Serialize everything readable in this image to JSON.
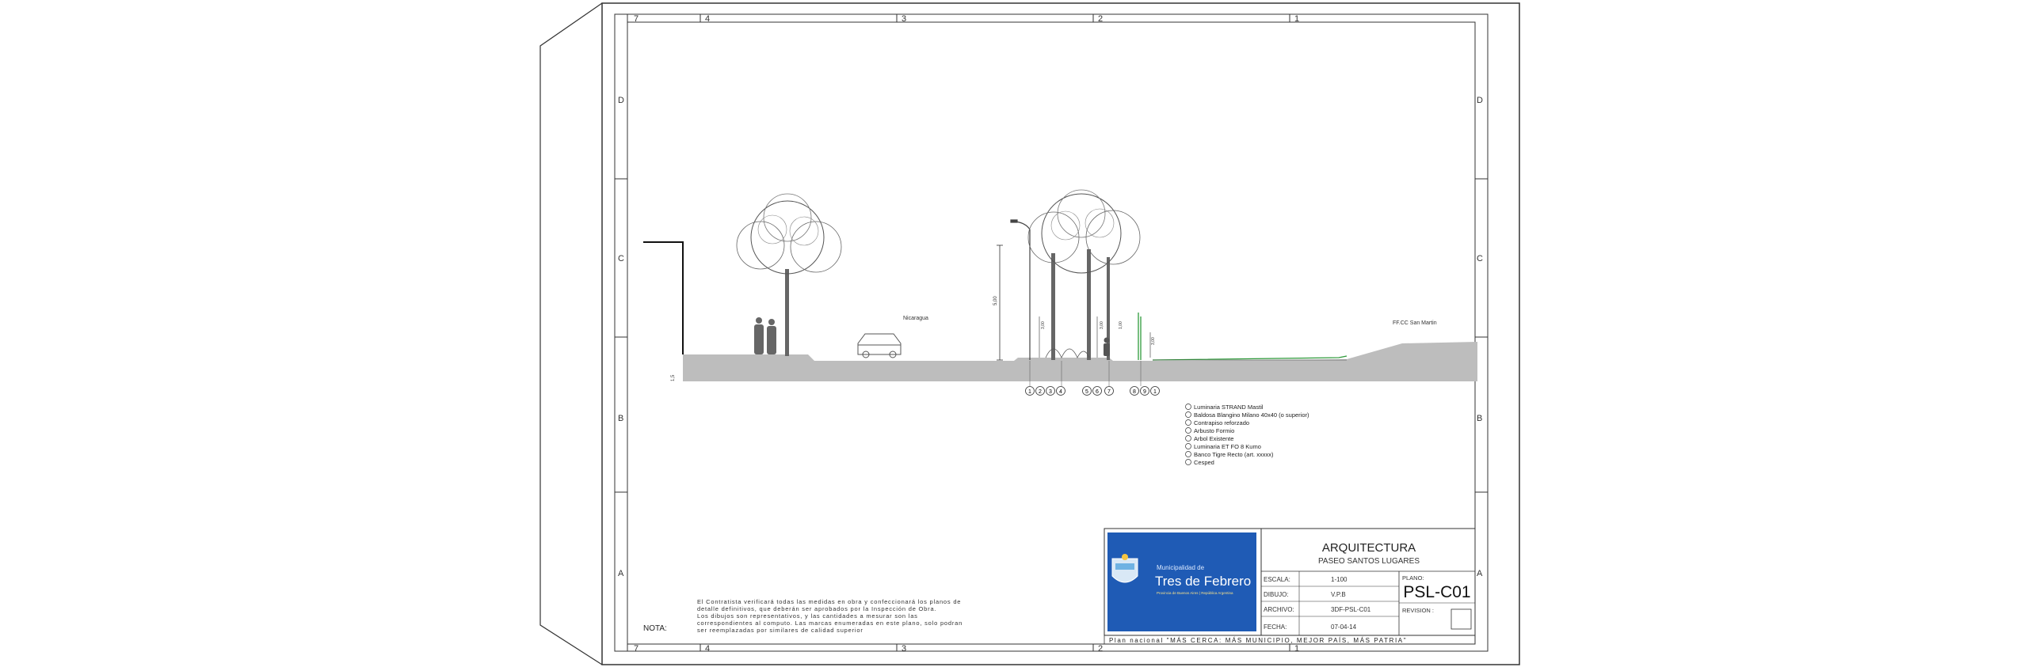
{
  "grid": {
    "top_cols": [
      "7",
      "4",
      "3",
      "2",
      "1"
    ],
    "bottom_cols": [
      "7",
      "4",
      "3",
      "2",
      "1"
    ],
    "left_rows": [
      "D",
      "C",
      "B",
      "A"
    ],
    "right_rows": [
      "D",
      "C",
      "B",
      "A"
    ]
  },
  "drawing": {
    "street_label": "Nicaragua",
    "rail_label": "FF.CC San Martin",
    "dims": [
      "5,00",
      "3,00",
      "3,00",
      "1,00",
      "3,00",
      "1,5"
    ],
    "markers": [
      "1",
      "2",
      "3",
      "4",
      "5",
      "6",
      "7",
      "8",
      "9",
      "1"
    ]
  },
  "legend": [
    "Luminaria STRAND Mastil",
    "Baldosa Blangino Milano 40x40 (o superior)",
    "Contrapiso reforzado",
    "Arbusto Formio",
    "Arbol Existente",
    "Luminaria ET FO 8 Kumo",
    "Banco Tigre Recto (art. xxxxx)",
    "Cesped"
  ],
  "note": {
    "label": "NOTA:",
    "lines": [
      "El Contratista verificará todas las medidas en obra y confeccionará los planos de",
      "detalle definitivos, que deberán ser aprobados por la Inspección de Obra.",
      "Los dibujos son representativos, y las cantidades a mesurar son las",
      "correspondientes al computo. Las marcas enumeradas en este plano, solo podran",
      "ser reemplazadas por similares de calidad superior"
    ]
  },
  "logo": {
    "small": "Municipalidad de",
    "big": "Tres de Febrero",
    "sub": "Provincia de Buenos Aires | República Argentina"
  },
  "title_block": {
    "discipline": "ARQUITECTURA",
    "project": "PASEO SANTOS LUGARES",
    "rows": [
      {
        "label": "ESCALA:",
        "value": "1-100"
      },
      {
        "label": "DIBUJO:",
        "value": "V.P.B"
      },
      {
        "label": "ARCHIVO:",
        "value": "3DF-PSL-C01"
      },
      {
        "label": "FECHA:",
        "value": "07-04-14"
      }
    ],
    "plano_label": "PLANO:",
    "plano_value": "PSL-C01",
    "revision_label": "REVISION :",
    "slogan": "Plan nacional \"MÁS CERCA: MÁS MUNICIPIO, MEJOR PAÍS, MÁS PATRIA\""
  },
  "colors": {
    "ground": "#bdbdbd",
    "logo_bg": "#1f5bb5",
    "green_line": "#2e9a3a"
  }
}
